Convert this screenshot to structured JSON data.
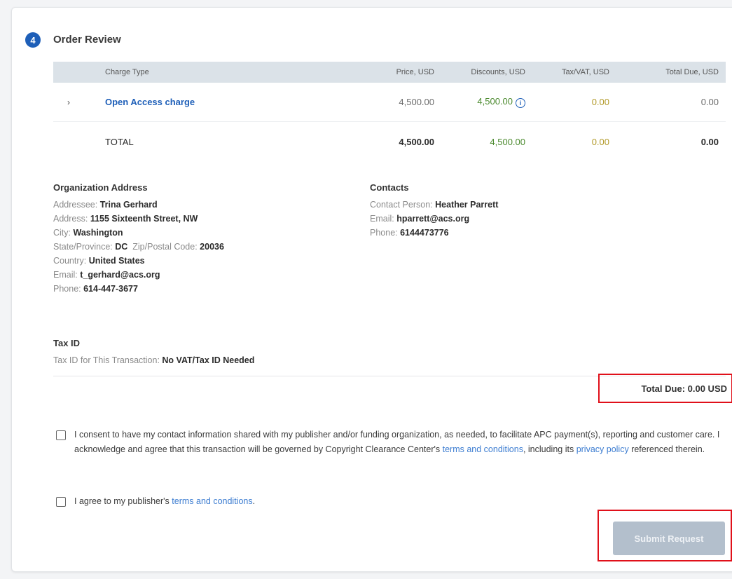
{
  "step": {
    "number": "4",
    "title": "Order Review"
  },
  "table": {
    "headers": {
      "charge_type": "Charge Type",
      "price": "Price, USD",
      "discounts": "Discounts, USD",
      "tax": "Tax/VAT, USD",
      "total_due": "Total Due, USD"
    },
    "rows": [
      {
        "expand": "›",
        "charge_type": "Open Access charge",
        "price": "4,500.00",
        "discounts": "4,500.00",
        "tax": "0.00",
        "total_due": "0.00"
      }
    ],
    "total": {
      "label": "TOTAL",
      "price": "4,500.00",
      "discounts": "4,500.00",
      "tax": "0.00",
      "total_due": "0.00"
    }
  },
  "org_address": {
    "title": "Organization Address",
    "addressee_label": "Addressee:",
    "addressee": "Trina Gerhard",
    "address_label": "Address:",
    "address": "1155 Sixteenth Street, NW",
    "city_label": "City:",
    "city": "Washington",
    "state_label": "State/Province:",
    "state": "DC",
    "zip_label": "Zip/Postal Code:",
    "zip": "20036",
    "country_label": "Country:",
    "country": "United States",
    "email_label": "Email:",
    "email": "t_gerhard@acs.org",
    "phone_label": "Phone:",
    "phone": "614-447-3677"
  },
  "contacts": {
    "title": "Contacts",
    "person_label": "Contact Person:",
    "person": "Heather Parrett",
    "email_label": "Email:",
    "email": "hparrett@acs.org",
    "phone_label": "Phone:",
    "phone": "6144473776"
  },
  "tax_id": {
    "title": "Tax ID",
    "label": "Tax ID for This Transaction:",
    "value": "No VAT/Tax ID Needed"
  },
  "total_due": "Total Due:  0.00 USD",
  "consent": {
    "text1": "I consent to have my contact information shared with my publisher and/or funding organization, as needed, to facilitate APC payment(s), reporting and customer care. I acknowledge and agree that this transaction will be governed by Copyright Clearance Center's ",
    "link1": "terms and conditions",
    "text2": ", including its ",
    "link2": "privacy policy",
    "text3": " referenced therein."
  },
  "agree": {
    "text1": "I agree to my publisher's ",
    "link": "terms and conditions",
    "text2": "."
  },
  "submit_label": "Submit Request",
  "colors": {
    "accent": "#1e5fb8",
    "discount": "#4b8a2e",
    "tax": "#b29a2a",
    "highlight": "#e0101a",
    "button_disabled": "#b3bfcc"
  }
}
